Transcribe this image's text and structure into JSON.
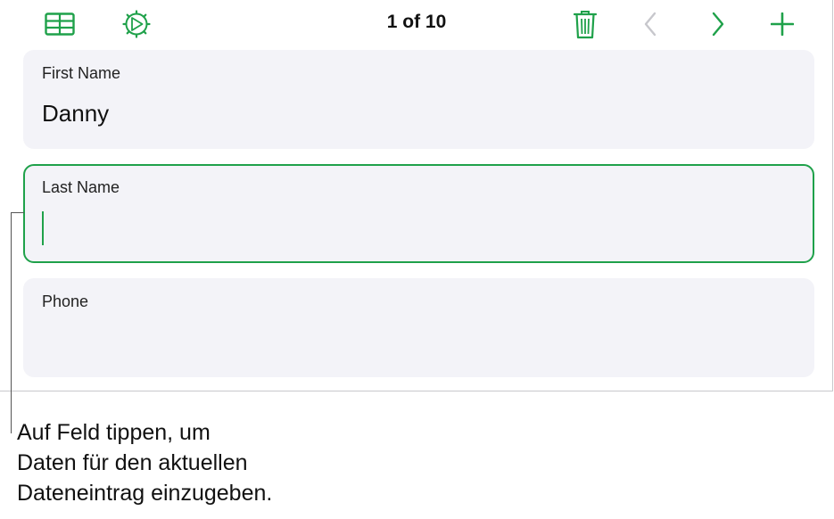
{
  "toolbar": {
    "table_view_icon": "table-grid-icon",
    "settings_icon": "gear-dial-icon",
    "record_counter": "1 of 10",
    "delete_icon": "trash-icon",
    "prev_icon": "chevron-left-icon",
    "next_icon": "chevron-right-icon",
    "add_icon": "plus-icon",
    "accent_color": "#1fa14a",
    "disabled_color": "#c7c7cc"
  },
  "fields": [
    {
      "label": "First Name",
      "value": "Danny",
      "active": false
    },
    {
      "label": "Last Name",
      "value": "",
      "active": true
    },
    {
      "label": "Phone",
      "value": "",
      "active": false
    }
  ],
  "callout": {
    "lines": [
      "Auf Feld tippen, um",
      "Daten für den aktuellen",
      "Dateneintrag einzugeben."
    ]
  }
}
